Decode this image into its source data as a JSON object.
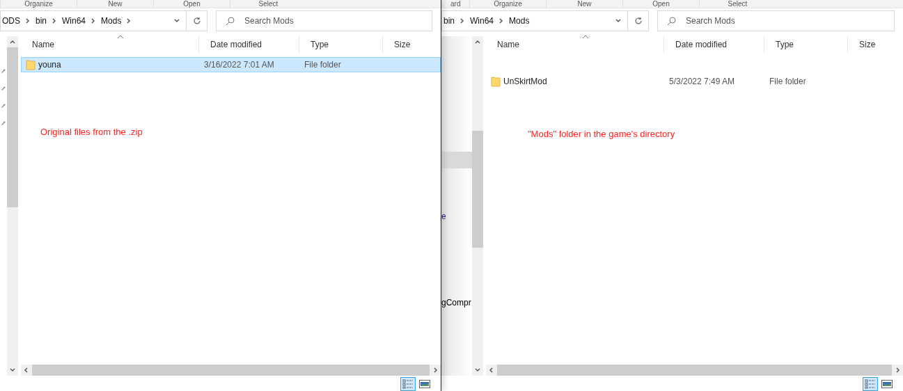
{
  "windows": [
    {
      "ribbon_groups": [
        "Organize",
        "New",
        "Open",
        "Select"
      ],
      "breadcrumb": [
        "ODS",
        "bin",
        "Win64",
        "Mods"
      ],
      "trailing_chevron": true,
      "search": {
        "placeholder": "Search Mods"
      },
      "columns": [
        "Name",
        "Date modified",
        "Type",
        "Size"
      ],
      "rows": [
        {
          "name": "youna",
          "date": "3/16/2022 7:01 AM",
          "type": "File folder",
          "selected": true
        }
      ],
      "annotation": "Original files from the .zip",
      "views": [
        {
          "kind": "details",
          "selected": true
        },
        {
          "kind": "thumbnails",
          "selected": false
        }
      ]
    },
    {
      "ribbon_groups": [
        "ard",
        "Organize",
        "New",
        "Open",
        "Select"
      ],
      "breadcrumb": [
        "bin",
        "Win64",
        "Mods"
      ],
      "trailing_chevron": false,
      "search": {
        "placeholder": "Search Mods"
      },
      "columns": [
        "Name",
        "Date modified",
        "Type",
        "Size"
      ],
      "rows": [
        {
          "name": "UnSkirtMod",
          "date": "5/3/2022 7:49 AM",
          "type": "File folder",
          "selected": false
        }
      ],
      "annotation": "\"Mods\" folder in the game's directory",
      "nav_fragments": [
        "e",
        "gCompr"
      ],
      "views": [
        {
          "kind": "details",
          "selected": true
        },
        {
          "kind": "thumbnails",
          "selected": false
        }
      ]
    }
  ]
}
